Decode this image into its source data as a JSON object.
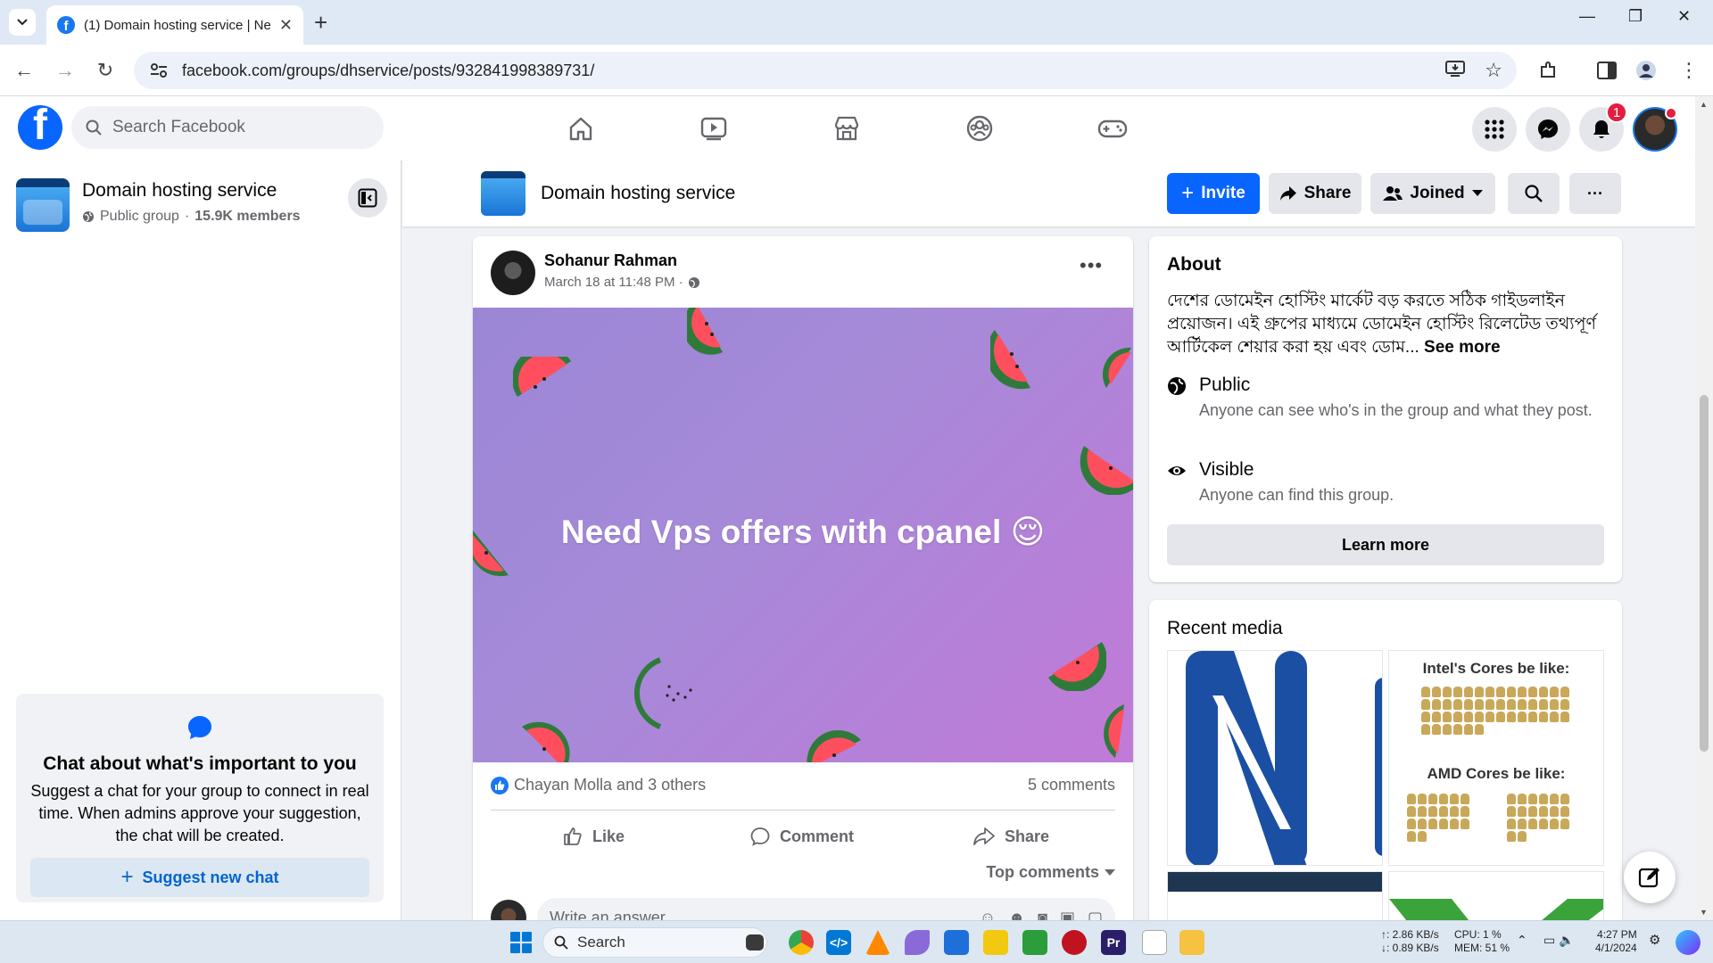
{
  "browser": {
    "tab_title": "(1) Domain hosting service | Ne",
    "url": "facebook.com/groups/dhservice/posts/932841998389731/"
  },
  "fb_header": {
    "logo": "f",
    "search_placeholder": "Search Facebook",
    "notifications_count": "1"
  },
  "sidebar": {
    "group_name": "Domain hosting service",
    "privacy": "Public group",
    "members": "15.9K members",
    "chat_card": {
      "title": "Chat about what's important to you",
      "body": "Suggest a chat for your group to connect in real time. When admins approve your suggestion, the chat will be created.",
      "button": "Suggest new chat"
    }
  },
  "group_header": {
    "name": "Domain hosting service",
    "invite": "Invite",
    "share": "Share",
    "joined": "Joined",
    "more": "···"
  },
  "post": {
    "author": "Sohanur Rahman",
    "time": "March 18 at 11:48 PM ·",
    "text": "Need Vps offers with cpanel 😌",
    "reactions": "Chayan Molla and 3 others",
    "comments": "5 comments",
    "actions": {
      "like": "Like",
      "comment": "Comment",
      "share": "Share"
    },
    "top_comments": "Top comments",
    "write_placeholder": "Write an answer..."
  },
  "about": {
    "title": "About",
    "description": "দেশের ডোমেইন হোস্টিং মার্কেট বড় করতে সঠিক গাইডলাইন প্রয়োজন। এই গ্রুপের মাধ্যমে ডোমেইন হোস্টিং রিলেটেড তথ্যপূর্ণ আর্টিকেল শেয়ার করা হয় এবং ডোম...",
    "see_more": "See more",
    "public_title": "Public",
    "public_desc": "Anyone can see who's in the group and what they post.",
    "visible_title": "Visible",
    "visible_desc": "Anyone can find this group.",
    "learn_more": "Learn more"
  },
  "recent_media": {
    "title": "Recent media",
    "intel_caption": "Intel's Cores be like:",
    "amd_caption": "AMD Cores be like:"
  },
  "taskbar": {
    "search": "Search",
    "net_up": "↑: 2.86 KB/s",
    "net_down": "↓: 0.89 KB/s",
    "cpu": "CPU: 1 %",
    "mem": "MEM: 51 %",
    "time": "4:27 PM",
    "date": "4/1/2024"
  },
  "colors": {
    "facebook_blue": "#0866ff",
    "post_gradient_start": "#9b86d6",
    "post_gradient_end": "#c17ad8"
  }
}
